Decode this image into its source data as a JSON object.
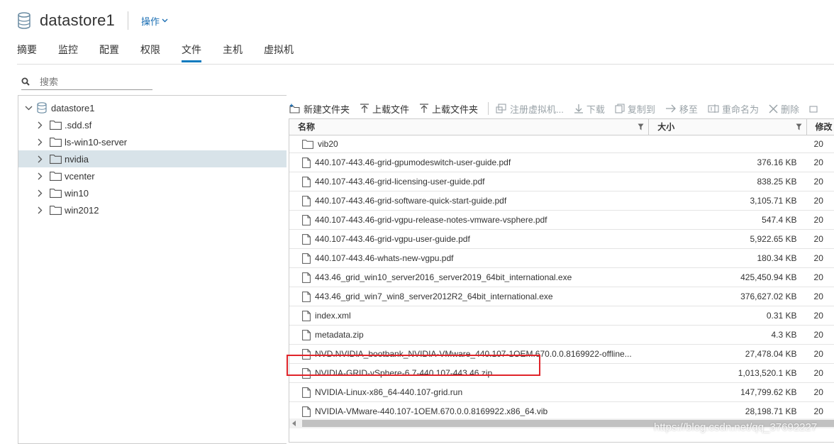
{
  "header": {
    "title": "datastore1",
    "actions_label": "操作"
  },
  "tabs": [
    {
      "label": "摘要"
    },
    {
      "label": "监控"
    },
    {
      "label": "配置"
    },
    {
      "label": "权限"
    },
    {
      "label": "文件",
      "active": true
    },
    {
      "label": "主机"
    },
    {
      "label": "虚拟机"
    }
  ],
  "search": {
    "placeholder": "搜索"
  },
  "tree": {
    "root": "datastore1",
    "items": [
      {
        "label": ".sdd.sf"
      },
      {
        "label": "ls-win10-server"
      },
      {
        "label": "nvidia",
        "selected": true
      },
      {
        "label": "vcenter"
      },
      {
        "label": "win10"
      },
      {
        "label": "win2012"
      }
    ]
  },
  "toolbar": {
    "new_folder": "新建文件夹",
    "upload_file": "上载文件",
    "upload_folder": "上载文件夹",
    "register_vm": "注册虚拟机...",
    "download": "下载",
    "copy_to": "复制到",
    "move_to": "移至",
    "rename": "重命名为",
    "delete": "删除"
  },
  "grid": {
    "columns": {
      "name": "名称",
      "size": "大小",
      "modified": "修改"
    },
    "rows": [
      {
        "name": "vib20",
        "size": "",
        "type": "folder",
        "mod": "20"
      },
      {
        "name": "440.107-443.46-grid-gpumodeswitch-user-guide.pdf",
        "size": "376.16 KB",
        "type": "file",
        "mod": "20"
      },
      {
        "name": "440.107-443.46-grid-licensing-user-guide.pdf",
        "size": "838.25 KB",
        "type": "file",
        "mod": "20"
      },
      {
        "name": "440.107-443.46-grid-software-quick-start-guide.pdf",
        "size": "3,105.71 KB",
        "type": "file",
        "mod": "20"
      },
      {
        "name": "440.107-443.46-grid-vgpu-release-notes-vmware-vsphere.pdf",
        "size": "547.4 KB",
        "type": "file",
        "mod": "20"
      },
      {
        "name": "440.107-443.46-grid-vgpu-user-guide.pdf",
        "size": "5,922.65 KB",
        "type": "file",
        "mod": "20"
      },
      {
        "name": "440.107-443.46-whats-new-vgpu.pdf",
        "size": "180.34 KB",
        "type": "file",
        "mod": "20"
      },
      {
        "name": "443.46_grid_win10_server2016_server2019_64bit_international.exe",
        "size": "425,450.94 KB",
        "type": "file",
        "mod": "20"
      },
      {
        "name": "443.46_grid_win7_win8_server2012R2_64bit_international.exe",
        "size": "376,627.02 KB",
        "type": "file",
        "mod": "20"
      },
      {
        "name": "index.xml",
        "size": "0.31 KB",
        "type": "file",
        "mod": "20"
      },
      {
        "name": "metadata.zip",
        "size": "4.3 KB",
        "type": "file",
        "mod": "20"
      },
      {
        "name": "NVD.NVIDIA_bootbank_NVIDIA-VMware_440.107-1OEM.670.0.0.8169922-offline...",
        "size": "27,478.04 KB",
        "type": "file",
        "mod": "20"
      },
      {
        "name": "NVIDIA-GRID-vSphere-6.7-440.107-443.46.zip",
        "size": "1,013,520.1 KB",
        "type": "file",
        "mod": "20"
      },
      {
        "name": "NVIDIA-Linux-x86_64-440.107-grid.run",
        "size": "147,799.62 KB",
        "type": "file",
        "mod": "20"
      },
      {
        "name": "NVIDIA-VMware-440.107-1OEM.670.0.0.8169922.x86_64.vib",
        "size": "28,198.71 KB",
        "type": "file",
        "mod": "20"
      }
    ]
  },
  "watermark": "https://blog.csdn.net/qq_37692227",
  "colors": {
    "accent": "#0f7bbf",
    "link": "#1a6eb3",
    "highlight": "#e0242a",
    "selected_row": "#d8e3e9"
  }
}
